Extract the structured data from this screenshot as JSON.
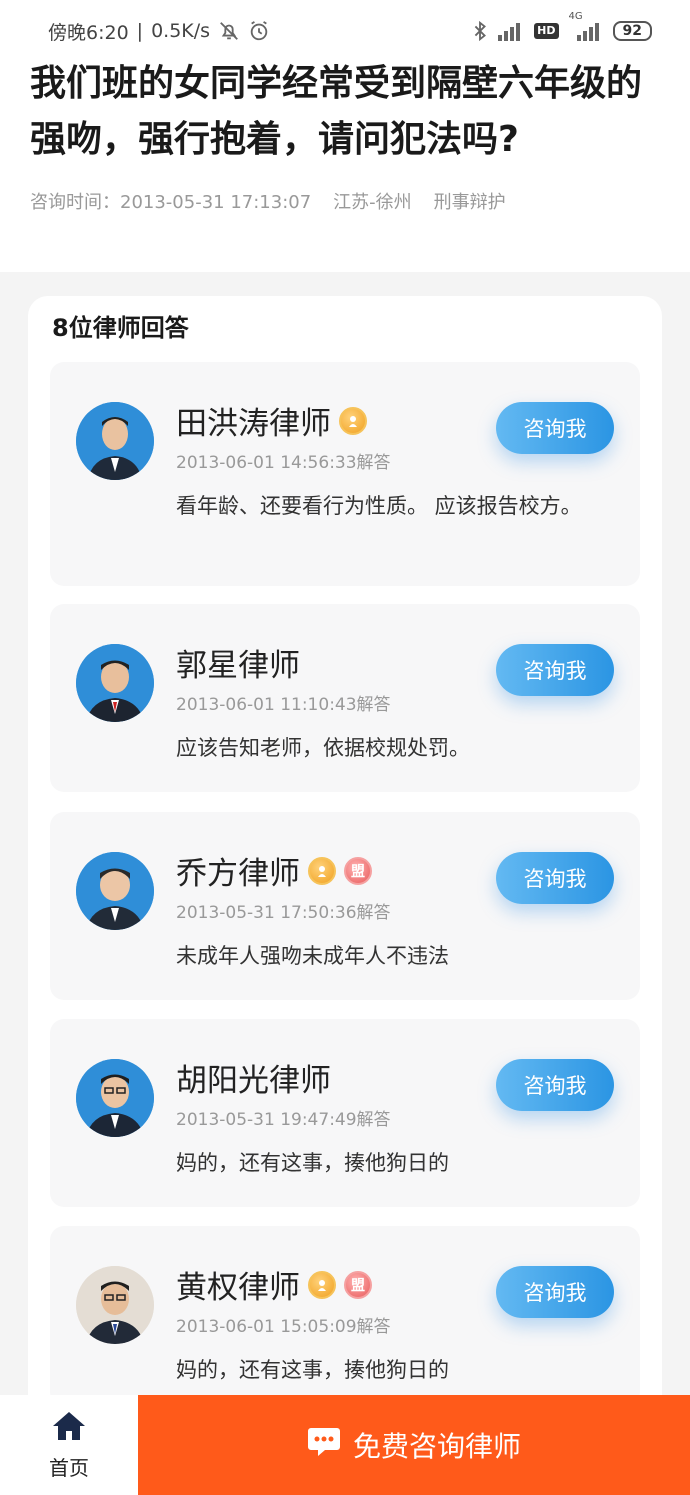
{
  "status_bar": {
    "time": "傍晚6:20",
    "speed": "0.5K/s",
    "hd": "HD",
    "network": "4G",
    "battery": "92"
  },
  "question": {
    "title": "我们班的女同学经常受到隔壁六年级的强吻，强行抱着，请问犯法吗?",
    "time_label": "咨询时间：2013-05-31 17:13:07",
    "location": "江苏-徐州",
    "category": "刑事辩护"
  },
  "answers_heading": "8位律师回答",
  "consult_label": "咨询我",
  "badge_red_text": "盟",
  "lawyers": [
    {
      "name": "田洪涛律师",
      "time": "2013-06-01 14:56:33解答",
      "answer": "看年龄、还要看行为性质。 应该报告校方。"
    },
    {
      "name": "郭星律师",
      "time": "2013-06-01 11:10:43解答",
      "answer": "应该告知老师，依据校规处罚。"
    },
    {
      "name": "乔方律师",
      "time": "2013-05-31 17:50:36解答",
      "answer": "未成年人强吻未成年人不违法"
    },
    {
      "name": "胡阳光律师",
      "time": "2013-05-31 19:47:49解答",
      "answer": "妈的，还有这事，揍他狗日的"
    },
    {
      "name": "黄权律师",
      "time": "2013-06-01 15:05:09解答",
      "answer": "妈的，还有这事，揍他狗日的"
    }
  ],
  "bottom_bar": {
    "home_label": "首页",
    "free_consult_label": "免费咨询律师"
  },
  "colors": {
    "accent_orange": "#ff5a1a",
    "button_blue": "#2b95e3"
  }
}
